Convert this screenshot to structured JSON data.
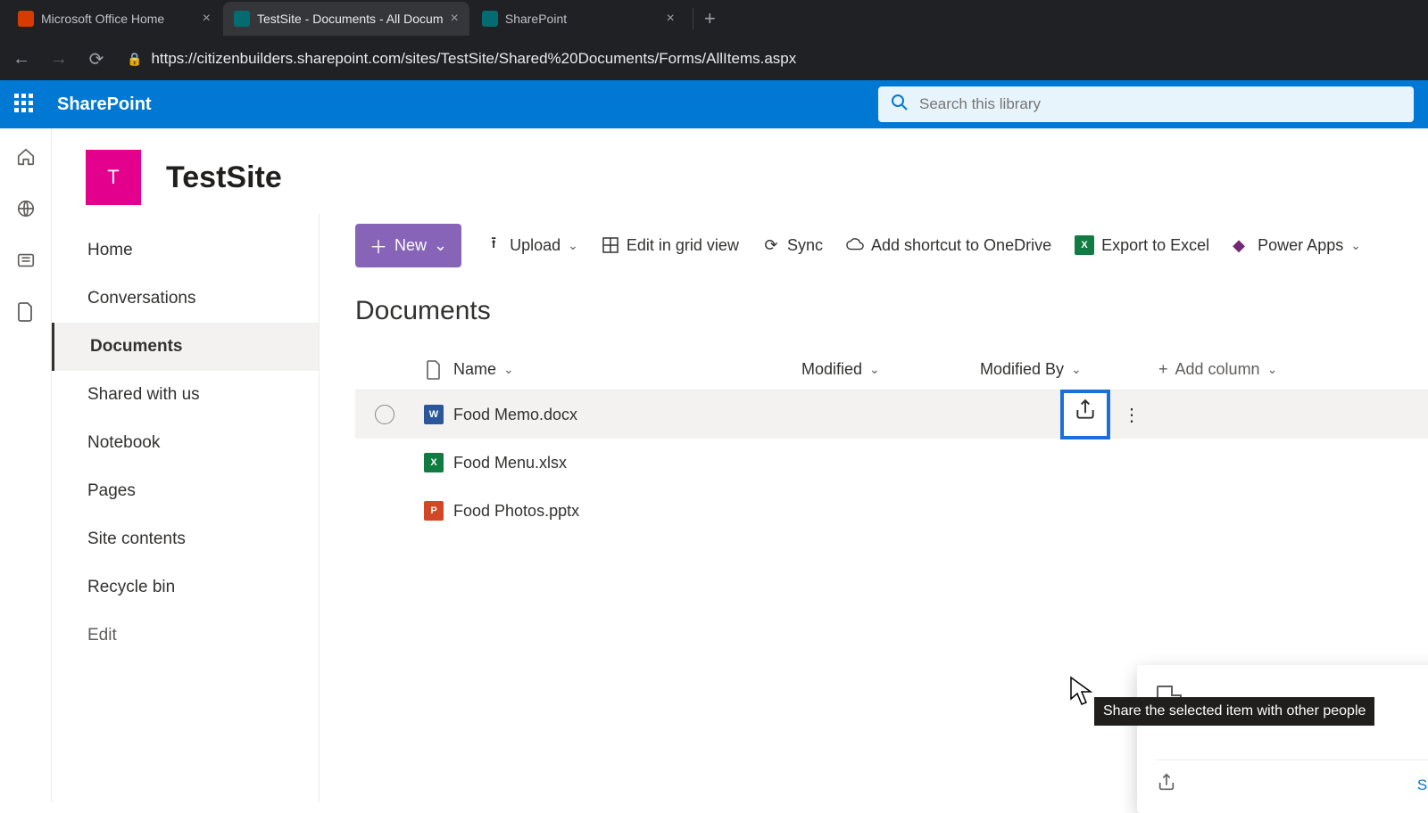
{
  "browser": {
    "tabs": [
      {
        "title": "Microsoft Office Home",
        "favicon": "#d83b01",
        "active": false
      },
      {
        "title": "TestSite - Documents - All Docum",
        "favicon": "#036c70",
        "active": true
      },
      {
        "title": "SharePoint",
        "favicon": "#036c70",
        "active": false
      }
    ],
    "url": "https://citizenbuilders.sharepoint.com/sites/TestSite/Shared%20Documents/Forms/AllItems.aspx"
  },
  "suite": {
    "brand": "SharePoint",
    "search_placeholder": "Search this library"
  },
  "site": {
    "logo_letter": "T",
    "title": "TestSite"
  },
  "nav": {
    "items": [
      "Home",
      "Conversations",
      "Documents",
      "Shared with us",
      "Notebook",
      "Pages",
      "Site contents",
      "Recycle bin"
    ],
    "edit": "Edit",
    "active_index": 2
  },
  "commands": {
    "new": "New",
    "upload": "Upload",
    "edit_grid": "Edit in grid view",
    "sync": "Sync",
    "shortcut": "Add shortcut to OneDrive",
    "export": "Export to Excel",
    "powerapps": "Power Apps"
  },
  "library": {
    "title": "Documents",
    "columns": {
      "name": "Name",
      "modified": "Modified",
      "modified_by": "Modified By",
      "add": "Add column"
    },
    "rows": [
      {
        "name": "Food Memo.docx",
        "type": "word",
        "hovered": true
      },
      {
        "name": "Food Menu.xlsx",
        "type": "excel",
        "hovered": false
      },
      {
        "name": "Food Photos.pptx",
        "type": "ppt",
        "hovered": false
      }
    ]
  },
  "tooltip": "Share the selected item with other people",
  "details": {
    "see": "See details"
  }
}
